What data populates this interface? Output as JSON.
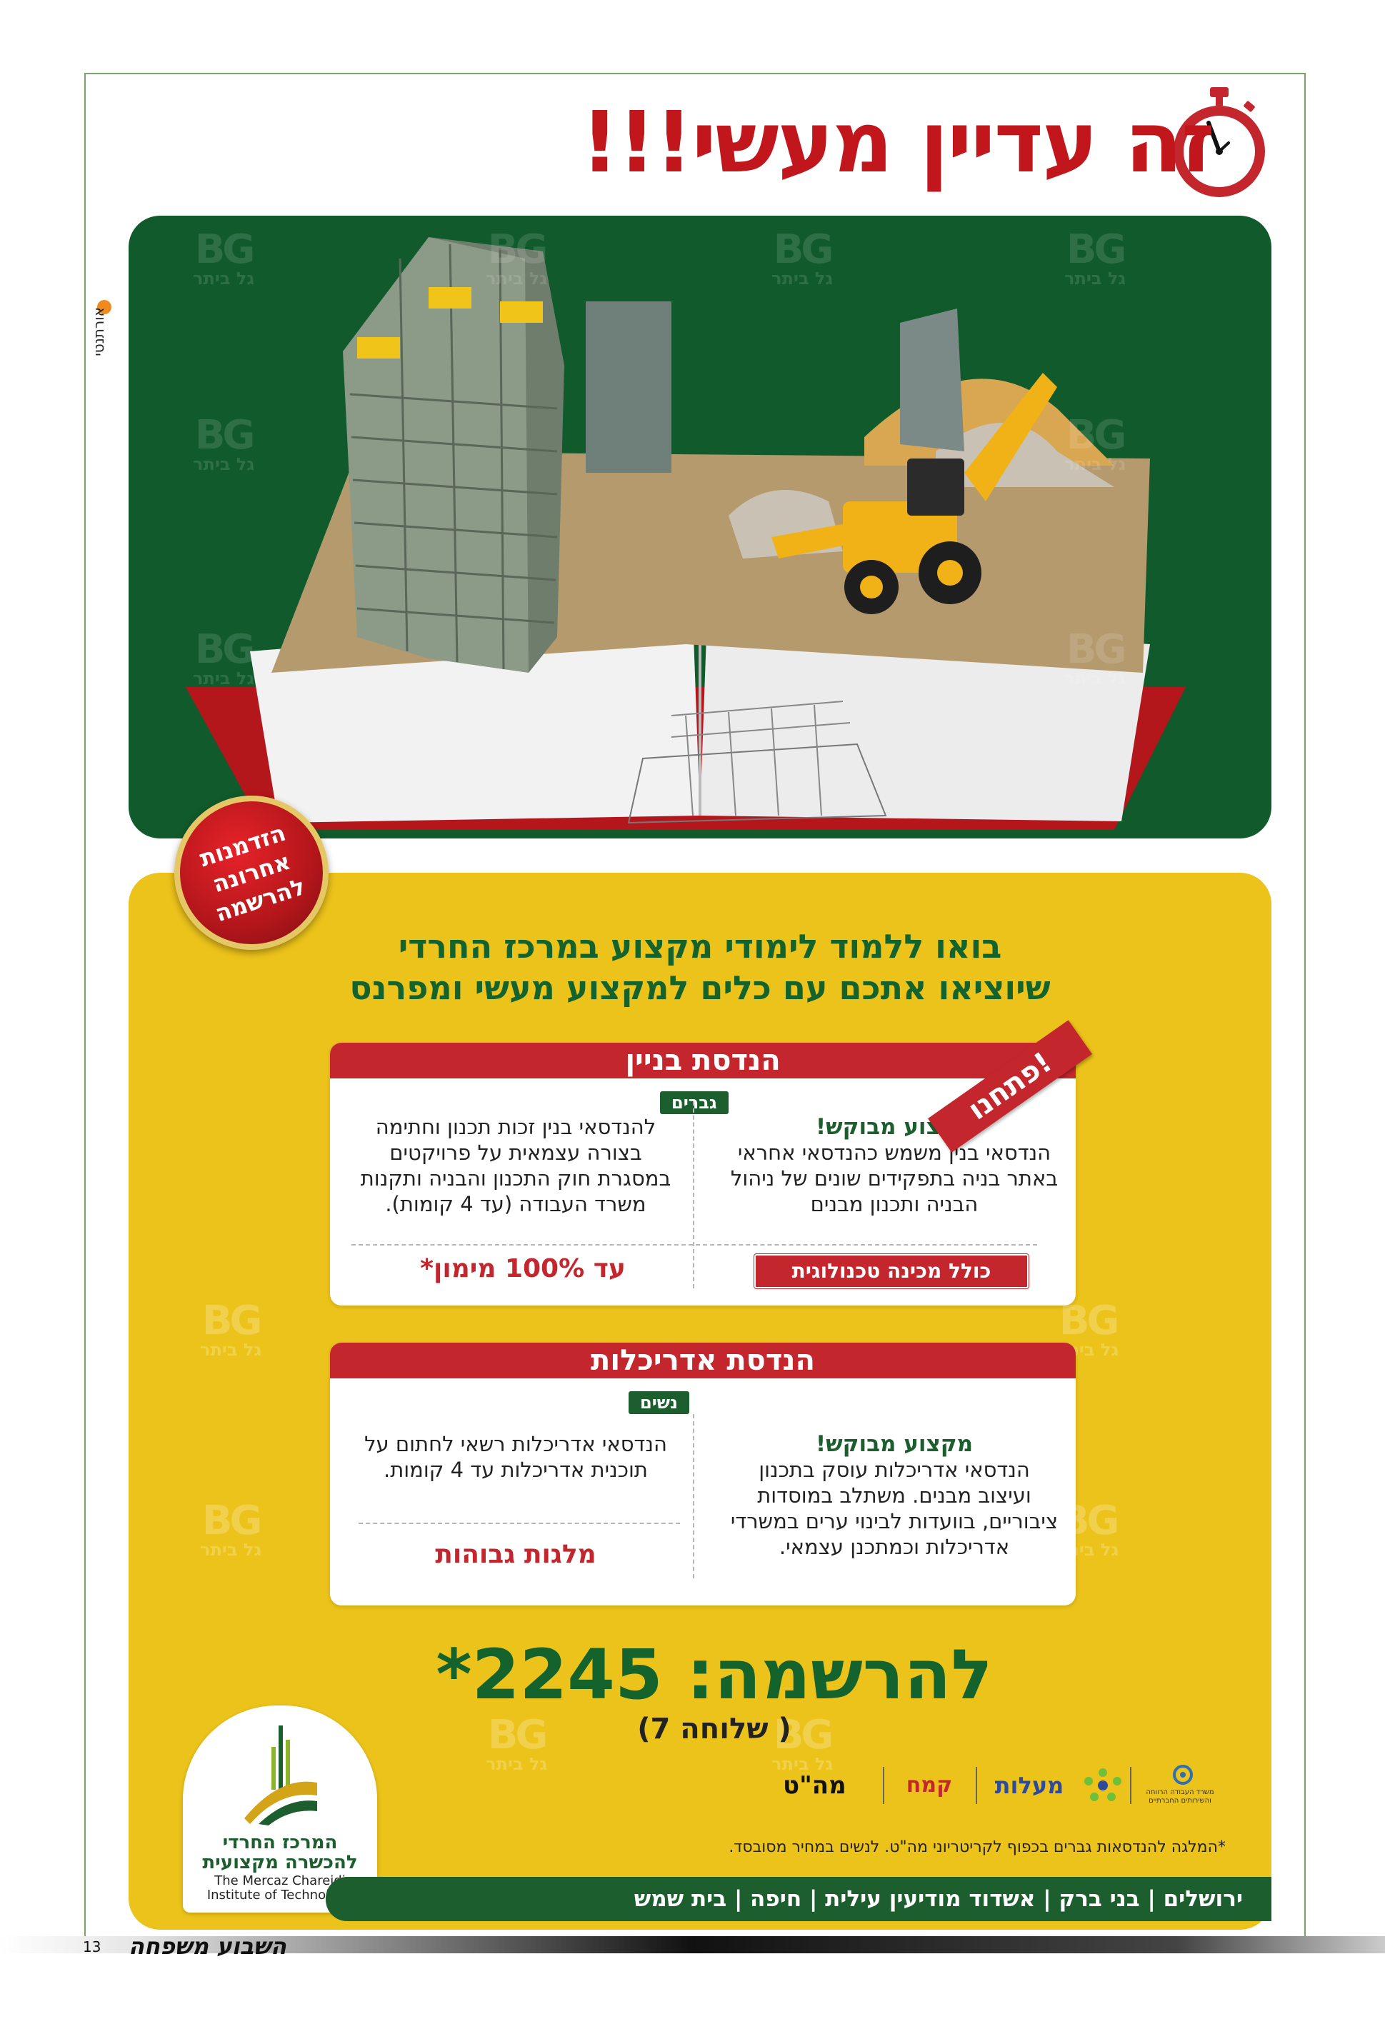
{
  "headline": "זה עדיין מעשי!!!",
  "side_tag": "אורתנטי",
  "watermark": {
    "letters": "BG",
    "sub": "גל ביתר"
  },
  "badge": "הזדמנות\nאחרונה\nלהרשמה",
  "intro": {
    "line1": "בואו ללמוד לימודי מקצוע במרכז החרדי",
    "line2": "שיוציאו אתכם עם כלים למקצוע מעשי ומפרנס"
  },
  "ribbon": "פתחנו!",
  "civil": {
    "title": "הנדסת בניין",
    "audience": "גברים",
    "right_heading": "מקצוע מבוקש!",
    "right_text": "הנדסאי בנין משמש כהנדסאי אחראי באתר בניה בתפקידים שונים של ניהול הבניה ותכנון מבנים",
    "left_text": "להנדסאי בנין זכות תכנון וחתימה בצורה עצמאית על פרויקטים במסגרת חוק התכנון והבניה ותקנות משרד העבודה (עד 4 קומות).",
    "tech_box": "כולל מכינה טכנולוגית",
    "funding": "עד 100% מימון*"
  },
  "arch": {
    "title": "הנדסת אדריכלות",
    "audience": "נשים",
    "right_heading": "מקצוע מבוקש!",
    "right_text": "הנדסאי אדריכלות עוסק בתכנון ועיצוב מבנים. משתלב במוסדות ציבוריים, בוועדות לבינוי ערים במשרדי אדריכלות וכמתכנן עצמאי.",
    "left_text": "הנדסאי אדריכלות רשאי לחתום על תוכנית אדריכלות עד 4 קומות.",
    "scholarship": "מלגות גבוהות"
  },
  "registration": {
    "label": "להרשמה: 2245*",
    "extension": "( שלוחה 7)"
  },
  "logo": {
    "he_line1": "המרכז החרדי",
    "he_line2": "להכשרה מקצועית",
    "en_line1": "The Mercaz Chareidi",
    "en_line2": "Institute of Technology"
  },
  "partners": [
    {
      "name": "מה\"ט"
    },
    {
      "name": "קמח"
    },
    {
      "name": "מעלות"
    },
    {
      "name": "משרד העבודה הרווחה והשירותים החברתיים"
    }
  ],
  "note": "*המלגה להנדסאות גברים בכפוף לקריטריוני מה\"ט. לנשים במחיר מסובסד.",
  "locations": "ירושלים | בני ברק | אשדוד מודיעין עילית | חיפה | בית שמש",
  "footer": {
    "page_number": "13",
    "paper": "השבוע משפחה"
  },
  "colors": {
    "green": "#115a2b",
    "yellow": "#ecc31a",
    "red": "#c4262e"
  }
}
